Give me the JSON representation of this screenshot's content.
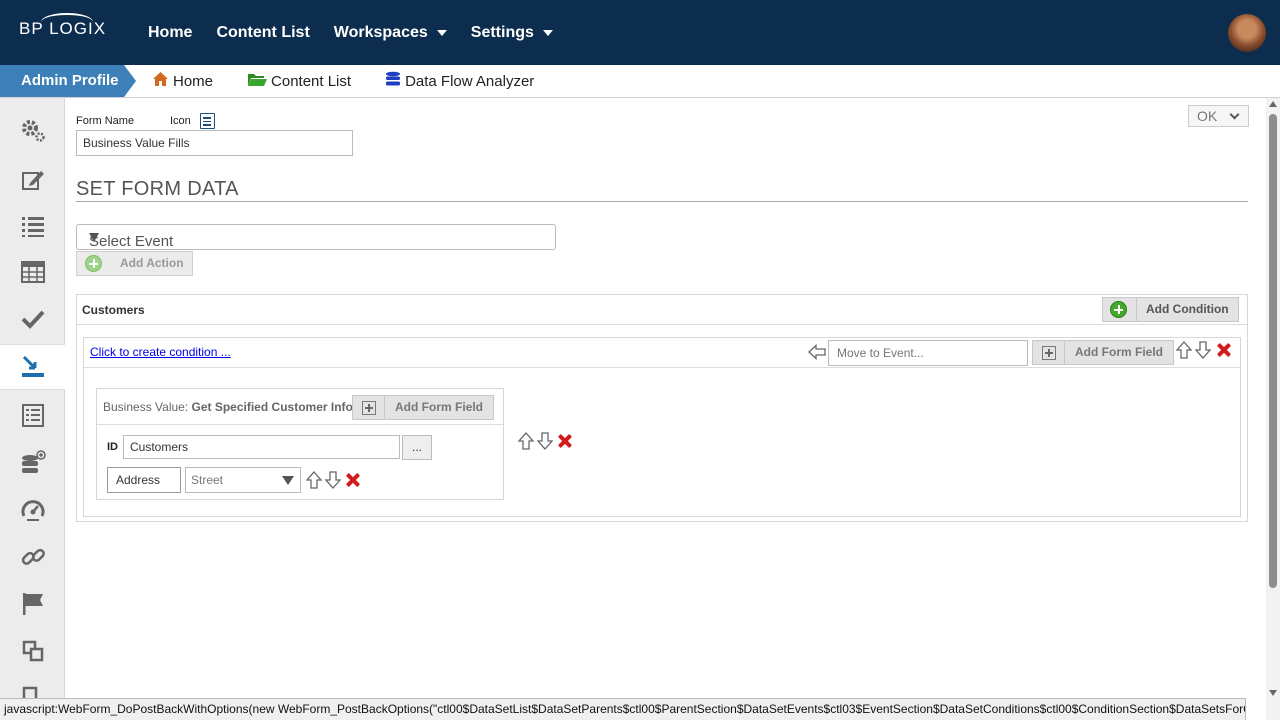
{
  "brand": {
    "logo_text": "BP LOGIX"
  },
  "topnav": {
    "items": [
      {
        "label": "Home"
      },
      {
        "label": "Content List"
      },
      {
        "label": "Workspaces"
      },
      {
        "label": "Settings"
      }
    ]
  },
  "subbar": {
    "admin_label": "Admin Profile",
    "crumbs": [
      {
        "label": "Home",
        "icon": "home-icon"
      },
      {
        "label": "Content List",
        "icon": "folder-icon"
      },
      {
        "label": "Data Flow Analyzer",
        "icon": "database-icon"
      }
    ]
  },
  "colors": {
    "topbar": "#0c2d4e",
    "admin_tab": "#3d7fb8",
    "link": "#0000ee",
    "delete": "#d21b1b",
    "add_green": "#46a82b"
  },
  "sidebar": {
    "icons": [
      "gears-icon",
      "edit-icon",
      "list-icon",
      "table-icon",
      "check-icon",
      "data-import-icon",
      "report-icon",
      "database-add-icon",
      "dashboard-icon",
      "link-icon",
      "flag-icon",
      "copy-icon"
    ],
    "active_index": 5
  },
  "form": {
    "name_label": "Form Name",
    "icon_label": "Icon",
    "name_value": "Business Value Fills",
    "ok_label": "OK"
  },
  "section": {
    "title": "SET FORM DATA",
    "select_event_placeholder": "Select Event",
    "add_action_label": "Add Action"
  },
  "customers": {
    "title": "Customers",
    "add_condition_label": "Add Condition",
    "condition": {
      "create_link": "Click to create condition ...",
      "move_placeholder": "Move to Event...",
      "add_form_field_label": "Add Form Field",
      "business_value": {
        "prefix": "Business Value: ",
        "name": "Get Specified Customer Info",
        "add_form_field_label": "Add Form Field",
        "id_label": "ID",
        "id_value": "Customers",
        "browse_label": "...",
        "field_value": "Address",
        "field_mapping": "Street"
      }
    }
  },
  "statusbar": {
    "text": "javascript:WebForm_DoPostBackWithOptions(new WebForm_PostBackOptions(\"ctl00$DataSetList$DataSetParents$ctl00$ParentSection$DataSetEvents$ctl03$EventSection$DataSetConditions$ctl00$ConditionSection$DataSetsForCon..."
  }
}
